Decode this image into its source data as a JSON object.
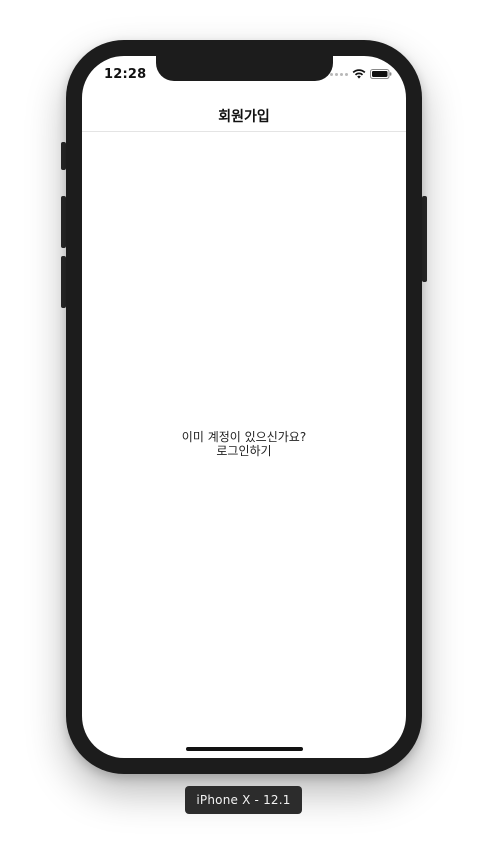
{
  "status_bar": {
    "time": "12:28"
  },
  "nav": {
    "title": "회원가입"
  },
  "main": {
    "prompt": "이미 계정이 있으신가요?",
    "login_link": "로그인하기"
  },
  "simulator": {
    "device_label": "iPhone X - 12.1"
  },
  "colors": {
    "device_frame": "#1c1c1c",
    "screen_background": "#ffffff",
    "label_background": "#2c2c2c"
  }
}
